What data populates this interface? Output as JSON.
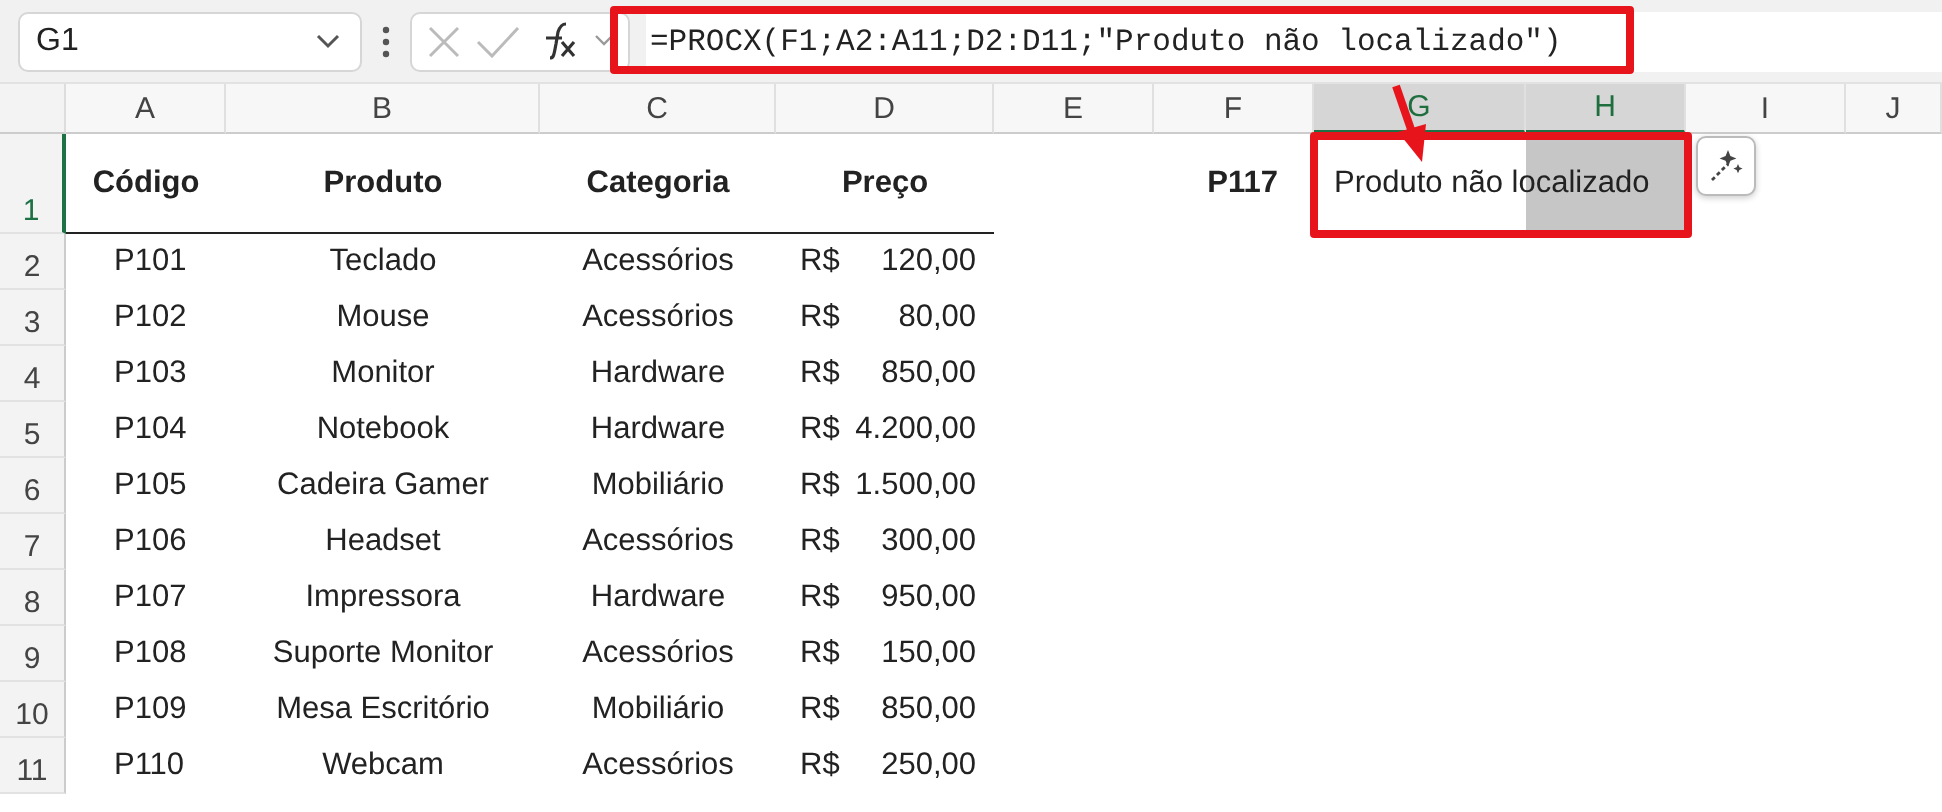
{
  "name_box": {
    "value": "G1"
  },
  "formula_bar": {
    "formula": "=PROCX(F1;A2:A11;D2:D11;\"Produto não localizado\")"
  },
  "columns": [
    {
      "label": "A",
      "selected": false
    },
    {
      "label": "B",
      "selected": false
    },
    {
      "label": "C",
      "selected": false
    },
    {
      "label": "D",
      "selected": false
    },
    {
      "label": "E",
      "selected": false
    },
    {
      "label": "F",
      "selected": false
    },
    {
      "label": "G",
      "selected": true
    },
    {
      "label": "H",
      "selected": true
    },
    {
      "label": "I",
      "selected": false
    },
    {
      "label": "J",
      "selected": false
    }
  ],
  "header_row": {
    "number": "1",
    "selected": true,
    "labels": [
      "Código",
      "Produto",
      "Categoria",
      "Preço"
    ],
    "lookup_value": "P117",
    "result": "Produto não localizado"
  },
  "rows": [
    {
      "number": "2",
      "selected": false,
      "code": "P101",
      "product": "Teclado",
      "category": "Acessórios",
      "currency": "R$",
      "price": "120,00"
    },
    {
      "number": "3",
      "selected": false,
      "code": "P102",
      "product": "Mouse",
      "category": "Acessórios",
      "currency": "R$",
      "price": "80,00"
    },
    {
      "number": "4",
      "selected": false,
      "code": "P103",
      "product": "Monitor",
      "category": "Hardware",
      "currency": "R$",
      "price": "850,00"
    },
    {
      "number": "5",
      "selected": false,
      "code": "P104",
      "product": "Notebook",
      "category": "Hardware",
      "currency": "R$",
      "price": "4.200,00"
    },
    {
      "number": "6",
      "selected": false,
      "code": "P105",
      "product": "Cadeira Gamer",
      "category": "Mobiliário",
      "currency": "R$",
      "price": "1.500,00"
    },
    {
      "number": "7",
      "selected": false,
      "code": "P106",
      "product": "Headset",
      "category": "Acessórios",
      "currency": "R$",
      "price": "300,00"
    },
    {
      "number": "8",
      "selected": false,
      "code": "P107",
      "product": "Impressora",
      "category": "Hardware",
      "currency": "R$",
      "price": "950,00"
    },
    {
      "number": "9",
      "selected": false,
      "code": "P108",
      "product": "Suporte Monitor",
      "category": "Acessórios",
      "currency": "R$",
      "price": "150,00"
    },
    {
      "number": "10",
      "selected": false,
      "code": "P109",
      "product": "Mesa Escritório",
      "category": "Mobiliário",
      "currency": "R$",
      "price": "850,00"
    },
    {
      "number": "11",
      "selected": false,
      "code": "P110",
      "product": "Webcam",
      "category": "Acessórios",
      "currency": "R$",
      "price": "250,00"
    }
  ]
}
